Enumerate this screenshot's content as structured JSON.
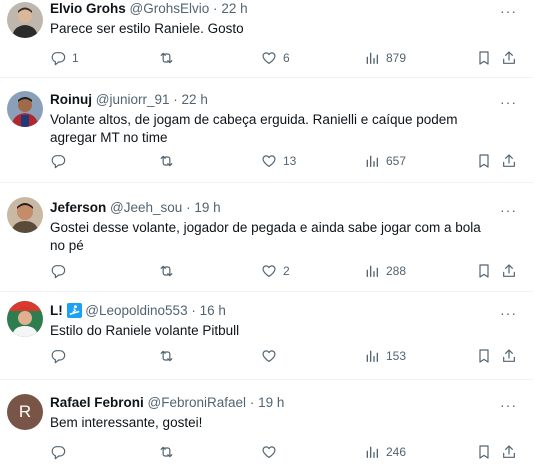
{
  "tweets": [
    {
      "name": "Elvio Grohs",
      "handle": "@GrohsElvio",
      "time": "22 h",
      "text": "Parece ser estilo Raniele. Gosto",
      "replies": "1",
      "retweets": "",
      "likes": "6",
      "views": "879",
      "avatar": "photo"
    },
    {
      "name": "Roinuj",
      "handle": "@juniorr_91",
      "time": "22 h",
      "text": "Volante altos, de jogam de cabeça erguida. Ranielli e caíque podem agregar MT no time",
      "replies": "",
      "retweets": "",
      "likes": "13",
      "views": "657",
      "avatar": "photo"
    },
    {
      "name": "Jeferson",
      "handle": "@Jeeh_sou",
      "time": "19 h",
      "text": "Gostei desse volante, jogador de pegada e ainda sabe jogar com a bola no pé",
      "replies": "",
      "retweets": "",
      "likes": "2",
      "views": "288",
      "avatar": "photo"
    },
    {
      "name": "L!",
      "handle": "@Leopoldino553",
      "time": "16 h",
      "text": "Estilo do Raniele volante Pitbull",
      "replies": "",
      "retweets": "",
      "likes": "",
      "views": "153",
      "avatar": "photo"
    },
    {
      "name": "Rafael Febroni",
      "handle": "@FebroniRafael",
      "time": "19 h",
      "text": "Bem interessante, gostei!",
      "replies": "",
      "retweets": "",
      "likes": "",
      "views": "246",
      "avatar": "initial",
      "initial": "R"
    }
  ],
  "more_glyph": "···",
  "separator": "·",
  "colors": {
    "text": "#0f1419",
    "secondary": "#536471",
    "divider": "#eff3f4",
    "avatar_initial_bg": "#795548"
  }
}
